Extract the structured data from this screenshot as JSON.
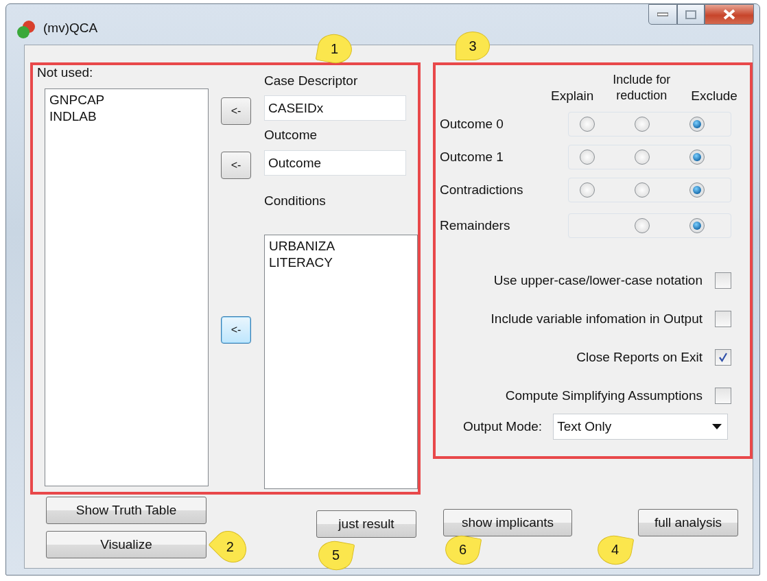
{
  "window": {
    "title": "(mv)QCA"
  },
  "not_used": {
    "label": "Not used:",
    "items": [
      "GNPCAP",
      "INDLAB"
    ]
  },
  "move_buttons": [
    {
      "label": "<-",
      "focused": false
    },
    {
      "label": "<-",
      "focused": false
    },
    {
      "label": "<-",
      "focused": true
    }
  ],
  "case_descriptor": {
    "label": "Case Descriptor",
    "value": "CASEIDx"
  },
  "outcome": {
    "label": "Outcome",
    "value": "Outcome"
  },
  "conditions": {
    "label": "Conditions",
    "items": [
      "URBANIZA",
      "LITERACY"
    ]
  },
  "treatment": {
    "columns": [
      "Explain",
      "Include for reduction",
      "Exclude"
    ],
    "rows": [
      {
        "label": "Outcome 0",
        "options": [
          {
            "kind": "radio",
            "selected": false
          },
          {
            "kind": "radio",
            "selected": false
          },
          {
            "kind": "radio",
            "selected": true
          }
        ]
      },
      {
        "label": "Outcome 1",
        "options": [
          {
            "kind": "radio",
            "selected": false
          },
          {
            "kind": "radio",
            "selected": false
          },
          {
            "kind": "radio",
            "selected": true
          }
        ]
      },
      {
        "label": "Contradictions",
        "options": [
          {
            "kind": "radio",
            "selected": false
          },
          {
            "kind": "radio",
            "selected": false
          },
          {
            "kind": "radio",
            "selected": true
          }
        ]
      },
      {
        "label": "Remainders",
        "options": [
          {
            "kind": "blank"
          },
          {
            "kind": "radio",
            "selected": false
          },
          {
            "kind": "radio",
            "selected": true
          }
        ]
      }
    ]
  },
  "settings": [
    {
      "label": "Use upper-case/lower-case notation",
      "checked": false
    },
    {
      "label": "Include variable infomation in Output",
      "checked": false
    },
    {
      "label": "Close Reports on Exit",
      "checked": true
    },
    {
      "label": "Compute Simplifying Assumptions",
      "checked": false
    }
  ],
  "output_mode": {
    "label": "Output Mode:",
    "value": "Text Only"
  },
  "left_buttons": [
    "Show Truth Table",
    "Visualize"
  ],
  "run_buttons": [
    "just result",
    "show implicants",
    "full analysis"
  ],
  "callouts": [
    {
      "label": "1"
    },
    {
      "label": "3"
    },
    {
      "label": "2"
    },
    {
      "label": "5"
    },
    {
      "label": "6"
    },
    {
      "label": "4"
    }
  ]
}
